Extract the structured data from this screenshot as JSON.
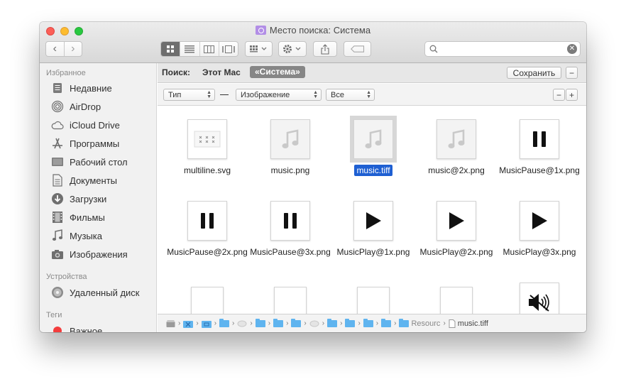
{
  "window": {
    "title": "Место поиска: Система"
  },
  "toolbar": {
    "back": "‹",
    "forward": "›",
    "search": {
      "value": "",
      "placeholder": ""
    }
  },
  "sidebar": {
    "favorites_title": "Избранное",
    "favorites": [
      {
        "label": "Недавние",
        "icon": "recents-icon"
      },
      {
        "label": "AirDrop",
        "icon": "airdrop-icon"
      },
      {
        "label": "iCloud Drive",
        "icon": "cloud-icon"
      },
      {
        "label": "Программы",
        "icon": "applications-icon"
      },
      {
        "label": "Рабочий стол",
        "icon": "desktop-icon"
      },
      {
        "label": "Документы",
        "icon": "documents-icon"
      },
      {
        "label": "Загрузки",
        "icon": "downloads-icon"
      },
      {
        "label": "Фильмы",
        "icon": "movies-icon"
      },
      {
        "label": "Музыка",
        "icon": "music-icon"
      },
      {
        "label": "Изображения",
        "icon": "pictures-icon"
      }
    ],
    "devices_title": "Устройства",
    "devices": [
      {
        "label": "Удаленный диск",
        "icon": "disk-icon"
      }
    ],
    "tags_title": "Теги",
    "tags": [
      {
        "label": "Важное",
        "color": "#f33d3d"
      }
    ]
  },
  "searchbar": {
    "label": "Поиск:",
    "this_mac": "Этот Mac",
    "scope": "«Система»",
    "save": "Сохранить",
    "minus": "−"
  },
  "filter": {
    "kind": "Тип",
    "type": "Изображение",
    "value": "Все",
    "minus": "−",
    "plus": "+"
  },
  "files": [
    {
      "name": "multiline.svg",
      "thumb": "svg",
      "selected": false
    },
    {
      "name": "music.png",
      "thumb": "note",
      "selected": false
    },
    {
      "name": "music.tiff",
      "thumb": "note",
      "selected": true
    },
    {
      "name": "music@2x.png",
      "thumb": "note",
      "selected": false
    },
    {
      "name": "MusicPause@1x.png",
      "thumb": "pause",
      "selected": false
    },
    {
      "name": "MusicPause@2x.png",
      "thumb": "pause",
      "selected": false
    },
    {
      "name": "MusicPause@3x.png",
      "thumb": "pause",
      "selected": false
    },
    {
      "name": "MusicPlay@1x.png",
      "thumb": "play",
      "selected": false
    },
    {
      "name": "MusicPlay@2x.png",
      "thumb": "play",
      "selected": false
    },
    {
      "name": "MusicPlay@3x.png",
      "thumb": "play",
      "selected": false
    },
    {
      "name": "",
      "thumb": "blank",
      "selected": false
    },
    {
      "name": "",
      "thumb": "blank",
      "selected": false
    },
    {
      "name": "",
      "thumb": "blank",
      "selected": false
    },
    {
      "name": "",
      "thumb": "blank",
      "selected": false
    },
    {
      "name": "",
      "thumb": "mute",
      "selected": false
    }
  ],
  "pathbar": {
    "resources": "Resourc",
    "file": "music.tiff"
  }
}
